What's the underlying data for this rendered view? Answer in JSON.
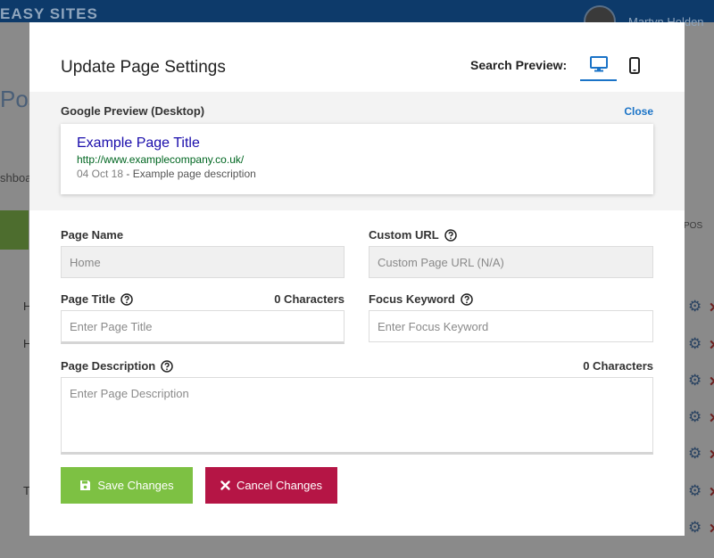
{
  "background": {
    "brand": "EASY SITES",
    "user_name": "Martyn Holden",
    "heading": "Posit",
    "breadcrumb": "shboa",
    "post_label": "POS",
    "row_letters": [
      "H",
      "H",
      "T"
    ]
  },
  "modal": {
    "title": "Update Page Settings",
    "search_preview_label": "Search Preview:",
    "preview": {
      "label": "Google Preview (Desktop)",
      "close_label": "Close",
      "title": "Example Page Title",
      "url": "http://www.examplecompany.co.uk/",
      "date": "04 Oct 18",
      "separator": " - ",
      "description": "Example page description"
    },
    "fields": {
      "page_name": {
        "label": "Page Name",
        "value": "Home"
      },
      "custom_url": {
        "label": "Custom URL",
        "placeholder": "Custom Page URL (N/A)"
      },
      "page_title": {
        "label": "Page Title",
        "counter": "0 Characters",
        "placeholder": "Enter Page Title"
      },
      "focus_keyword": {
        "label": "Focus Keyword",
        "placeholder": "Enter Focus Keyword"
      },
      "page_description": {
        "label": "Page Description",
        "counter": "0 Characters",
        "placeholder": "Enter Page Description"
      }
    },
    "buttons": {
      "save": "Save Changes",
      "cancel": "Cancel Changes"
    }
  },
  "icons": {
    "desktop": "desktop-icon",
    "mobile": "mobile-icon",
    "help": "question-circle-icon",
    "save": "floppy-disk-icon",
    "cancel": "x-icon",
    "gear": "gear-icon"
  },
  "colors": {
    "accent": "#1a73c7",
    "save": "#7dc143",
    "cancel": "#b51545",
    "link_title": "#1a0dab",
    "link_url": "#006621"
  }
}
